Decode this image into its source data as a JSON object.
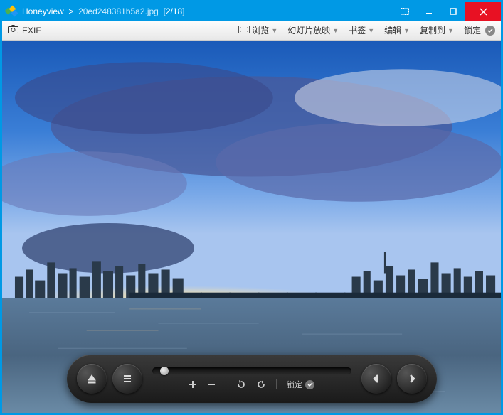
{
  "title": {
    "app": "Honeyview",
    "sep": ">",
    "filename": "20ed248381b5a2.jpg",
    "counter": "[2/18]"
  },
  "toolbar": {
    "exif": "EXIF",
    "browse": "浏览",
    "slideshow": "幻灯片放映",
    "bookmark": "书签",
    "edit": "编辑",
    "copyto": "复制到",
    "lock": "锁定"
  },
  "controls": {
    "lock": "锁定"
  }
}
